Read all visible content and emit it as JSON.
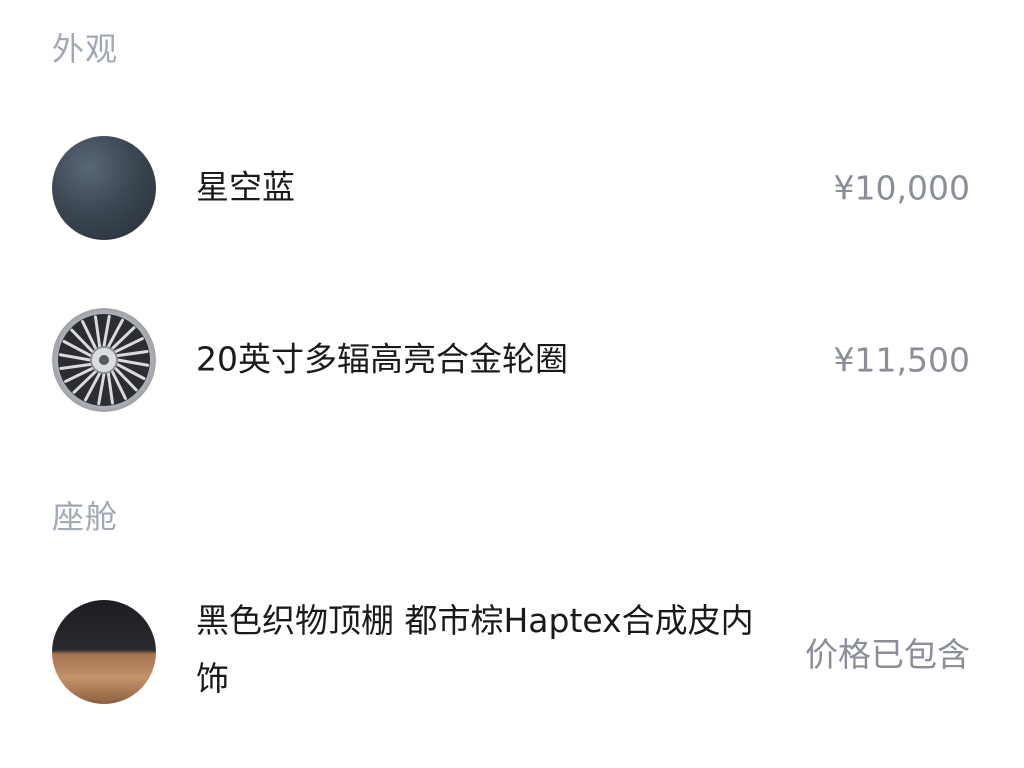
{
  "sections": {
    "exterior": {
      "title": "外观",
      "paint": {
        "name": "星空蓝",
        "price": "¥10,000",
        "swatch_color": "#3c4753"
      },
      "wheel": {
        "name": "20英寸多辐高亮合金轮圈",
        "price": "¥11,500",
        "swatch_icon": "alloy-wheel-icon"
      }
    },
    "cabin": {
      "title": "座舱",
      "interior": {
        "name": "黑色织物顶棚 都市棕Haptex合成皮内饰",
        "price": "价格已包含",
        "swatch_colors": [
          "#1c1d21",
          "#a67350"
        ]
      }
    }
  }
}
